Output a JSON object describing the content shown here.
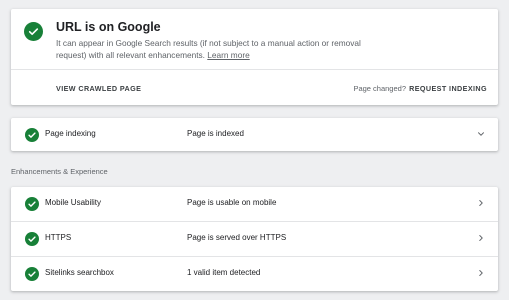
{
  "summary": {
    "title": "URL is on Google",
    "description": "It can appear in Google Search results (if not subject to a manual action or removal request) with all relevant enhancements.",
    "learn_more": "Learn more",
    "view_crawled_page": "VIEW CRAWLED PAGE",
    "page_changed": "Page changed?",
    "request_indexing": "REQUEST INDEXING"
  },
  "indexing": {
    "label": "Page indexing",
    "status": "Page is indexed"
  },
  "enhancements": {
    "heading": "Enhancements & Experience",
    "items": [
      {
        "label": "Mobile Usability",
        "status": "Page is usable on mobile"
      },
      {
        "label": "HTTPS",
        "status": "Page is served over HTTPS"
      },
      {
        "label": "Sitelinks searchbox",
        "status": "1 valid item detected"
      }
    ]
  },
  "colors": {
    "success": "#188038",
    "background": "#eeeff1"
  },
  "icons": {
    "status": "check-circle-icon",
    "expand": "chevron-down-icon",
    "navigate": "chevron-right-icon"
  }
}
